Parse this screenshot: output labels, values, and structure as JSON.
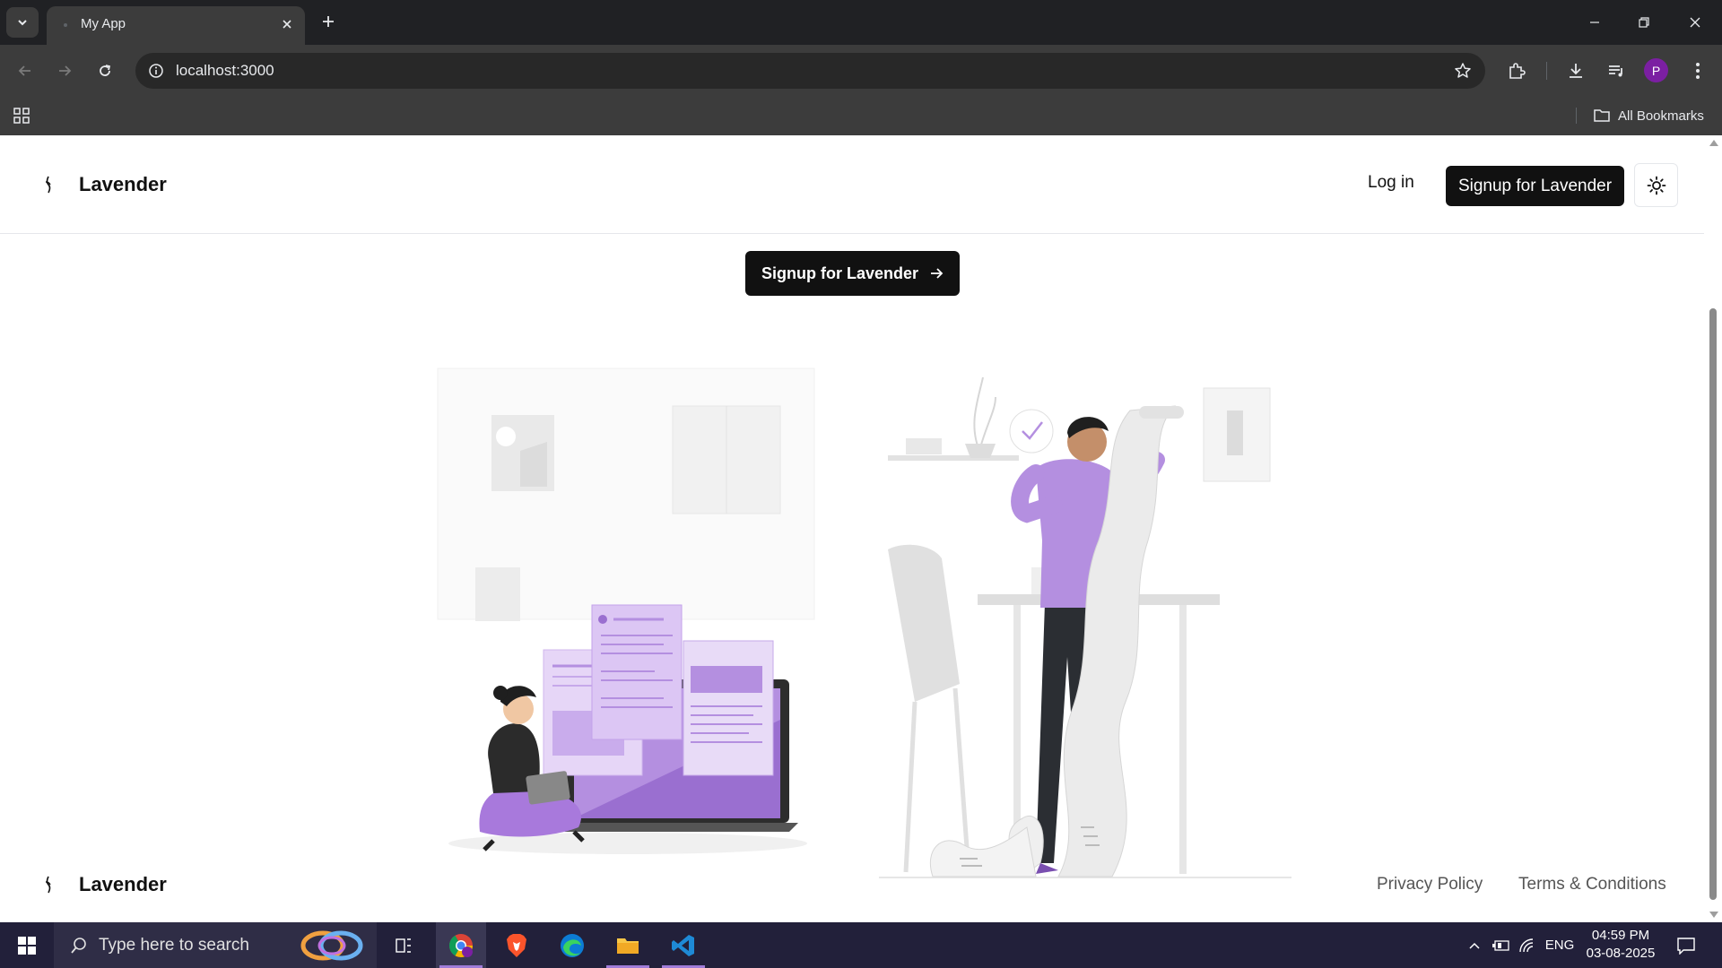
{
  "browser": {
    "tab_title": "My App",
    "url": "localhost:3000",
    "all_bookmarks": "All Bookmarks",
    "avatar_letter": "P"
  },
  "header": {
    "brand": "Lavender",
    "login": "Log in",
    "signup": "Signup for Lavender"
  },
  "hero": {
    "cta": "Signup for Lavender"
  },
  "footer": {
    "brand": "Lavender",
    "privacy": "Privacy Policy",
    "terms": "Terms & Conditions"
  },
  "taskbar": {
    "search_placeholder": "Type here to search",
    "language": "ENG",
    "time": "04:59 PM",
    "date": "03-08-2025"
  },
  "colors": {
    "accent_purple": "#b48fe0",
    "button_dark": "#111111",
    "chrome_dark": "#202124"
  }
}
